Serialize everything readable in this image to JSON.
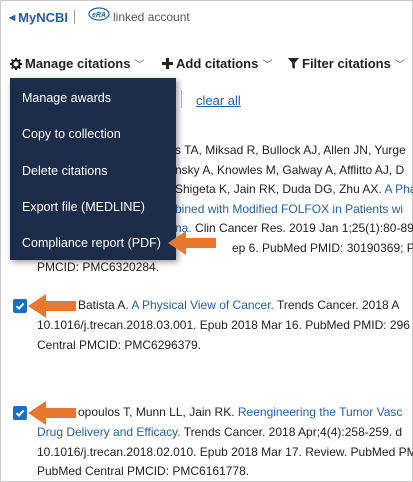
{
  "header": {
    "mync_label": "MyNCBI",
    "linked_label": "linked account"
  },
  "toolbar": {
    "manage_label": "Manage citations",
    "add_label": "Add citations",
    "filter_label": "Filter citations"
  },
  "selection": {
    "clear_all": "clear all"
  },
  "menu": {
    "items": [
      {
        "label": "Manage awards"
      },
      {
        "label": "Copy to collection"
      },
      {
        "label": "Delete citations"
      },
      {
        "label": "Export file (MEDLINE)"
      },
      {
        "label": "Compliance report (PDF)"
      }
    ]
  },
  "entries": [
    {
      "lines": [
        {
          "text": "s TA, Miksad R, Bullock AJ, Allen JN, Yurge"
        },
        {
          "text": "nsky A, Knowles M, Galway A, Afflitto AJ, D"
        },
        {
          "pre": "Shigeta K, Jain RK, Duda DG, Zhu AX. ",
          "link": "A Pha"
        },
        {
          "link": "bined with Modified FOLFOX in Patients wi"
        },
        {
          "link": "na.",
          "post": " Clin Cancer Res. 2019 Jan 1;25(1):80-89"
        },
        {
          "text": "ep 6. PubMed PMID: 30190369; Pub"
        },
        {
          "text": "PMCID: PMC6320284."
        }
      ]
    },
    {
      "lines": [
        {
          "pre": "Batista A. ",
          "link": "A Physical View of Cancer.",
          "post": " Trends Cancer. 2018 A"
        },
        {
          "text": "10.1016/j.trecan.2018.03.001. Epub 2018 Mar 16. PubMed PMID: 296"
        },
        {
          "text": "Central PMCID: PMC6296379."
        }
      ]
    },
    {
      "lines": [
        {
          "pre": "opoulos T, Munn LL, Jain RK. ",
          "link": "Reengineering the Tumor Vasc"
        },
        {
          "link": "Drug Delivery and Efficacy.",
          "post": " Trends Cancer. 2018 Apr;4(4):258-259. d"
        },
        {
          "text": "10.1016/j.trecan.2018.02.010. Epub 2018 Mar 17. Review. PubMed PMID"
        },
        {
          "text": "PubMed Central PMCID: PMC6161778."
        }
      ]
    }
  ],
  "colors": {
    "link": "#2460a7",
    "menu_bg": "#1b2d48",
    "checkbox": "#1a6fc4",
    "arrow": "#e8782e"
  },
  "icons": [
    "back-triangle-icon",
    "era-logo-icon",
    "gear-icon",
    "plus-icon",
    "filter-icon",
    "chevron-down-icon",
    "checkmark-icon",
    "arrow-pointer-icon"
  ]
}
